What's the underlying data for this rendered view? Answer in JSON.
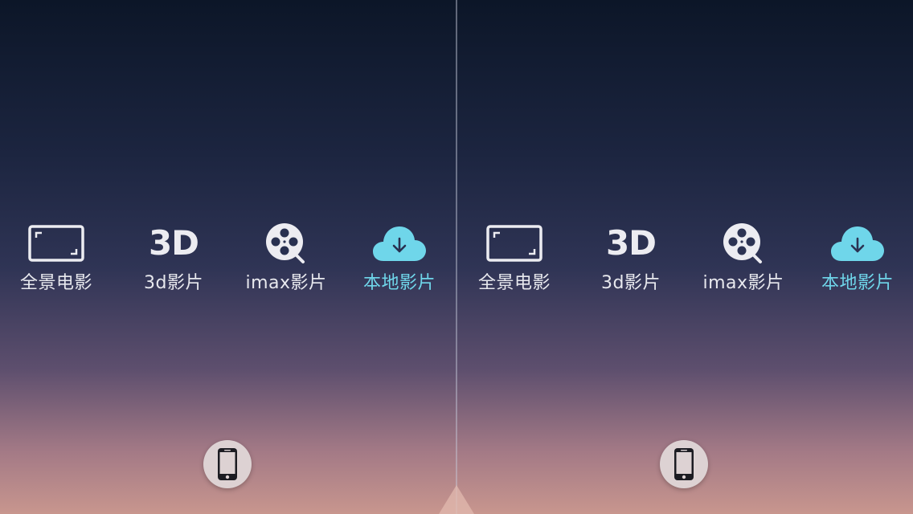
{
  "left_eye": {
    "menu": [
      {
        "label": "全景电影",
        "icon": "panorama-frame-icon"
      },
      {
        "label": "3d影片",
        "icon": "3d-badge-icon",
        "icon_text": "3D"
      },
      {
        "label": "imax影片",
        "icon": "film-reel-icon"
      },
      {
        "label": "本地影片",
        "icon": "cloud-download-icon",
        "active": true
      }
    ],
    "phone_button": {
      "icon": "smartphone-icon"
    }
  },
  "right_eye": {
    "menu": [
      {
        "label": "全景电影",
        "icon": "panorama-frame-icon"
      },
      {
        "label": "3d影片",
        "icon": "3d-badge-icon",
        "icon_text": "3D"
      },
      {
        "label": "imax影片",
        "icon": "film-reel-icon"
      },
      {
        "label": "本地影片",
        "icon": "cloud-download-icon",
        "active": true
      }
    ],
    "phone_button": {
      "icon": "smartphone-icon"
    }
  },
  "colors": {
    "active": "#6fd6ea",
    "text": "#e8e9ee",
    "button_bg": "#ddd2d3"
  }
}
